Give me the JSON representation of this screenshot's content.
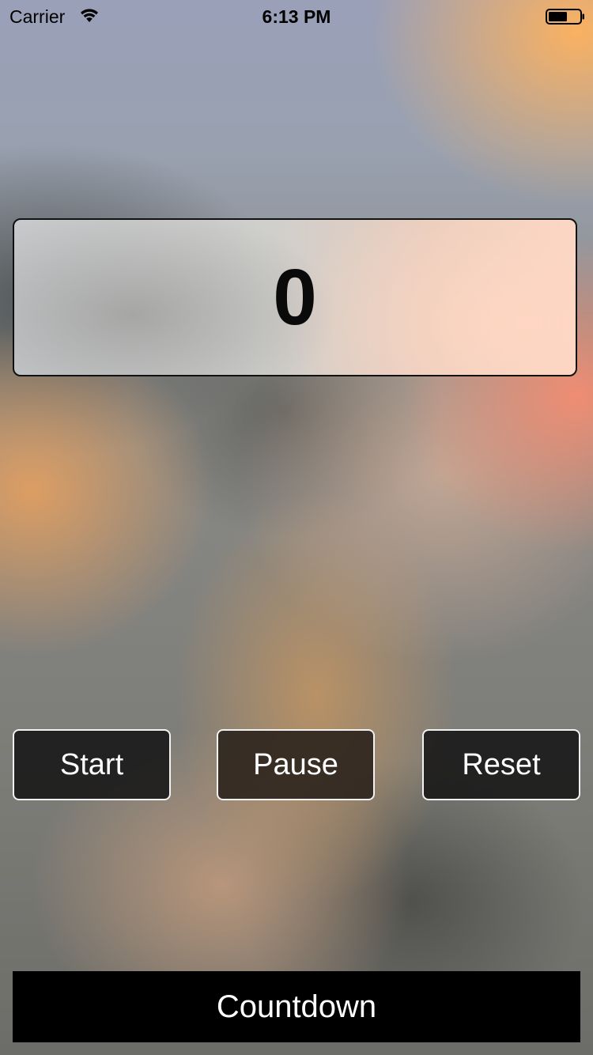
{
  "status_bar": {
    "carrier": "Carrier",
    "time": "6:13 PM",
    "wifi_icon": "wifi-icon",
    "battery_icon": "battery-icon"
  },
  "counter": {
    "value": "0"
  },
  "controls": {
    "start_label": "Start",
    "pause_label": "Pause",
    "reset_label": "Reset"
  },
  "footer": {
    "countdown_label": "Countdown"
  },
  "colors": {
    "button_border": "#f2f2f2",
    "button_bg": "#161616",
    "footer_bg": "#000000",
    "counter_text": "#0a0a0a"
  }
}
